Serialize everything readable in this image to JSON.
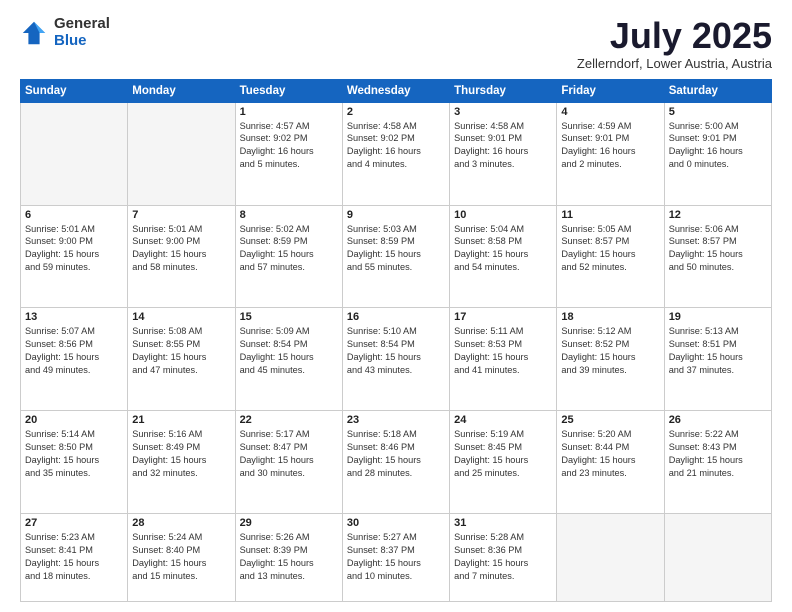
{
  "logo": {
    "general": "General",
    "blue": "Blue"
  },
  "title": "July 2025",
  "location": "Zellerndorf, Lower Austria, Austria",
  "days_of_week": [
    "Sunday",
    "Monday",
    "Tuesday",
    "Wednesday",
    "Thursday",
    "Friday",
    "Saturday"
  ],
  "weeks": [
    [
      {
        "day": "",
        "info": ""
      },
      {
        "day": "",
        "info": ""
      },
      {
        "day": "1",
        "info": "Sunrise: 4:57 AM\nSunset: 9:02 PM\nDaylight: 16 hours\nand 5 minutes."
      },
      {
        "day": "2",
        "info": "Sunrise: 4:58 AM\nSunset: 9:02 PM\nDaylight: 16 hours\nand 4 minutes."
      },
      {
        "day": "3",
        "info": "Sunrise: 4:58 AM\nSunset: 9:01 PM\nDaylight: 16 hours\nand 3 minutes."
      },
      {
        "day": "4",
        "info": "Sunrise: 4:59 AM\nSunset: 9:01 PM\nDaylight: 16 hours\nand 2 minutes."
      },
      {
        "day": "5",
        "info": "Sunrise: 5:00 AM\nSunset: 9:01 PM\nDaylight: 16 hours\nand 0 minutes."
      }
    ],
    [
      {
        "day": "6",
        "info": "Sunrise: 5:01 AM\nSunset: 9:00 PM\nDaylight: 15 hours\nand 59 minutes."
      },
      {
        "day": "7",
        "info": "Sunrise: 5:01 AM\nSunset: 9:00 PM\nDaylight: 15 hours\nand 58 minutes."
      },
      {
        "day": "8",
        "info": "Sunrise: 5:02 AM\nSunset: 8:59 PM\nDaylight: 15 hours\nand 57 minutes."
      },
      {
        "day": "9",
        "info": "Sunrise: 5:03 AM\nSunset: 8:59 PM\nDaylight: 15 hours\nand 55 minutes."
      },
      {
        "day": "10",
        "info": "Sunrise: 5:04 AM\nSunset: 8:58 PM\nDaylight: 15 hours\nand 54 minutes."
      },
      {
        "day": "11",
        "info": "Sunrise: 5:05 AM\nSunset: 8:57 PM\nDaylight: 15 hours\nand 52 minutes."
      },
      {
        "day": "12",
        "info": "Sunrise: 5:06 AM\nSunset: 8:57 PM\nDaylight: 15 hours\nand 50 minutes."
      }
    ],
    [
      {
        "day": "13",
        "info": "Sunrise: 5:07 AM\nSunset: 8:56 PM\nDaylight: 15 hours\nand 49 minutes."
      },
      {
        "day": "14",
        "info": "Sunrise: 5:08 AM\nSunset: 8:55 PM\nDaylight: 15 hours\nand 47 minutes."
      },
      {
        "day": "15",
        "info": "Sunrise: 5:09 AM\nSunset: 8:54 PM\nDaylight: 15 hours\nand 45 minutes."
      },
      {
        "day": "16",
        "info": "Sunrise: 5:10 AM\nSunset: 8:54 PM\nDaylight: 15 hours\nand 43 minutes."
      },
      {
        "day": "17",
        "info": "Sunrise: 5:11 AM\nSunset: 8:53 PM\nDaylight: 15 hours\nand 41 minutes."
      },
      {
        "day": "18",
        "info": "Sunrise: 5:12 AM\nSunset: 8:52 PM\nDaylight: 15 hours\nand 39 minutes."
      },
      {
        "day": "19",
        "info": "Sunrise: 5:13 AM\nSunset: 8:51 PM\nDaylight: 15 hours\nand 37 minutes."
      }
    ],
    [
      {
        "day": "20",
        "info": "Sunrise: 5:14 AM\nSunset: 8:50 PM\nDaylight: 15 hours\nand 35 minutes."
      },
      {
        "day": "21",
        "info": "Sunrise: 5:16 AM\nSunset: 8:49 PM\nDaylight: 15 hours\nand 32 minutes."
      },
      {
        "day": "22",
        "info": "Sunrise: 5:17 AM\nSunset: 8:47 PM\nDaylight: 15 hours\nand 30 minutes."
      },
      {
        "day": "23",
        "info": "Sunrise: 5:18 AM\nSunset: 8:46 PM\nDaylight: 15 hours\nand 28 minutes."
      },
      {
        "day": "24",
        "info": "Sunrise: 5:19 AM\nSunset: 8:45 PM\nDaylight: 15 hours\nand 25 minutes."
      },
      {
        "day": "25",
        "info": "Sunrise: 5:20 AM\nSunset: 8:44 PM\nDaylight: 15 hours\nand 23 minutes."
      },
      {
        "day": "26",
        "info": "Sunrise: 5:22 AM\nSunset: 8:43 PM\nDaylight: 15 hours\nand 21 minutes."
      }
    ],
    [
      {
        "day": "27",
        "info": "Sunrise: 5:23 AM\nSunset: 8:41 PM\nDaylight: 15 hours\nand 18 minutes."
      },
      {
        "day": "28",
        "info": "Sunrise: 5:24 AM\nSunset: 8:40 PM\nDaylight: 15 hours\nand 15 minutes."
      },
      {
        "day": "29",
        "info": "Sunrise: 5:26 AM\nSunset: 8:39 PM\nDaylight: 15 hours\nand 13 minutes."
      },
      {
        "day": "30",
        "info": "Sunrise: 5:27 AM\nSunset: 8:37 PM\nDaylight: 15 hours\nand 10 minutes."
      },
      {
        "day": "31",
        "info": "Sunrise: 5:28 AM\nSunset: 8:36 PM\nDaylight: 15 hours\nand 7 minutes."
      },
      {
        "day": "",
        "info": ""
      },
      {
        "day": "",
        "info": ""
      }
    ]
  ]
}
